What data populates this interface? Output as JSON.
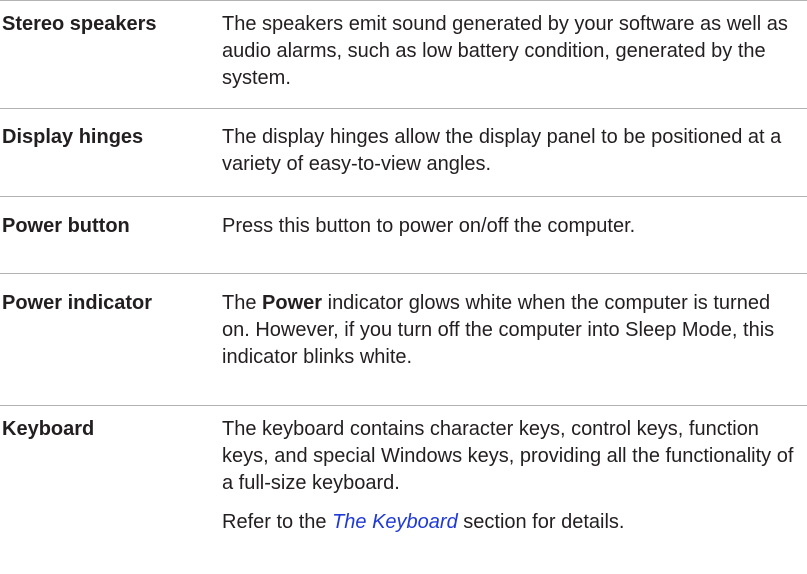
{
  "rows": [
    {
      "term": "Stereo speakers",
      "desc": "The speakers emit sound generated by your software as well as audio alarms, such as low battery condition, generated by the system."
    },
    {
      "term": "Display hinges",
      "desc": "The display hinges allow the display panel to be positioned at a variety of easy-to-view angles."
    },
    {
      "term": "Power button",
      "desc": "Press this button to power on/off the computer."
    },
    {
      "term": "Power indicator",
      "desc_pre": "The ",
      "desc_bold": "Power",
      "desc_post": " indicator glows white when the computer is turned on. However, if you turn off the computer into Sleep Mode, this indicator blinks white."
    },
    {
      "term": "Keyboard",
      "desc": "The keyboard contains character keys, control keys, function keys, and special Windows keys, providing all the functionality of a full-size keyboard.",
      "note_pre": "Refer to the ",
      "note_link": "The Keyboard",
      "note_post": " section for details."
    }
  ]
}
